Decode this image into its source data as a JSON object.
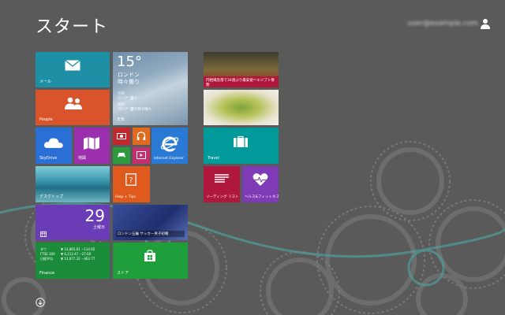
{
  "screen": {
    "title": "スタート"
  },
  "user": {
    "name": "user@example.com",
    "icon": "user-icon"
  },
  "tiles": {
    "mail": {
      "label": "メール",
      "color": "#1e90a6",
      "icon": "mail-icon"
    },
    "people": {
      "label": "People",
      "color": "#d9542b",
      "icon": "people-icon"
    },
    "weather": {
      "temp": "15°",
      "city": "ロンドン",
      "cond": "時々曇り",
      "today_label": "今日",
      "today_value": "21°/7° 曇り",
      "tomorrow_label": "明日",
      "tomorrow_value": "20°/7° 曇り時々晴れ",
      "label": "天気"
    },
    "news": {
      "headline": "円相場急落で34週ぶり最安値＝エジプト情勢"
    },
    "onedrive": {
      "label": "SkyDrive",
      "color": "#2a6fd6",
      "icon": "cloud-icon"
    },
    "maps": {
      "label": "地図",
      "color": "#9b2fae",
      "icon": "map-icon"
    },
    "camera": {
      "color": "#c1272d",
      "icon": "camera-icon"
    },
    "music": {
      "color": "#e06a1e",
      "icon": "headphones-icon"
    },
    "games": {
      "color": "#2e9a3e",
      "icon": "gamepad-icon"
    },
    "video": {
      "color": "#c42f6e",
      "icon": "video-icon"
    },
    "ie": {
      "label": "Internet Explorer",
      "color": "#2a7ad5",
      "icon": "ie-icon"
    },
    "travel": {
      "label": "Travel",
      "color": "#009a9a",
      "icon": "suitcase-icon"
    },
    "desktop": {
      "label": "デスクトップ"
    },
    "help": {
      "label": "Help + Tips",
      "color": "#e05a1e",
      "icon": "help-icon"
    },
    "reading": {
      "label": "リーディング リスト",
      "color": "#b0173d",
      "icon": "reading-list-icon"
    },
    "health": {
      "label": "ヘルス&フィットネス",
      "color": "#7e3bb5",
      "icon": "heart-icon"
    },
    "calendar": {
      "day": "29",
      "weekday": "土曜日",
      "color": "#6a3cb5",
      "icon": "calendar-icon"
    },
    "sports": {
      "headline": "ロンドン五輪 サッカー男子初戦"
    },
    "finance": {
      "label": "Finance",
      "color": "#1a8c3a",
      "rows": [
        {
          "name": "ダウ",
          "value": "▼ 14,865.61 −114.65"
        },
        {
          "name": "FTSE 100",
          "value": "▼ 6,213.47 −27.60"
        },
        {
          "name": "日経平均",
          "value": "▼ 13,677.32 −463.77"
        }
      ]
    },
    "store": {
      "label": "ストア",
      "color": "#1f9e3c",
      "icon": "store-icon"
    }
  },
  "footer": {
    "icon": "down-arrow-icon"
  }
}
